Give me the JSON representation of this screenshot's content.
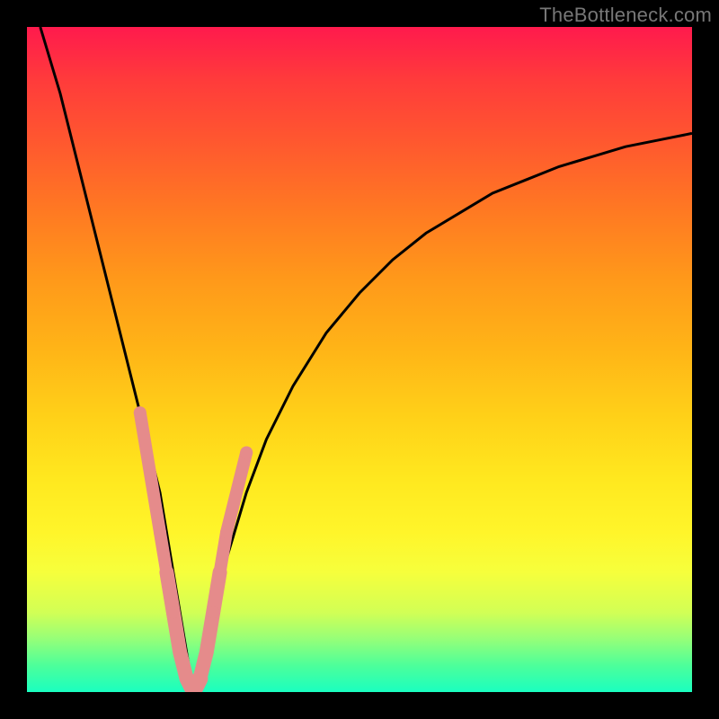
{
  "watermark": "TheBottleneck.com",
  "colors": {
    "frame": "#000000",
    "curve": "#000000",
    "marker_fill": "#e58b8b",
    "marker_stroke": "#d47272",
    "gradient_stops": [
      "#ff1a4d",
      "#ff3b3b",
      "#ff5a2e",
      "#ff7a22",
      "#ff991a",
      "#ffb317",
      "#ffcf18",
      "#ffe81f",
      "#fff52a",
      "#f6ff3c",
      "#d2ff55",
      "#96ff78",
      "#4dff9a",
      "#1affc0"
    ]
  },
  "chart_data": {
    "type": "line",
    "title": "",
    "xlabel": "",
    "ylabel": "",
    "xlim": [
      0,
      100
    ],
    "ylim": [
      0,
      100
    ],
    "note": "V-shaped bottleneck curve. y≈100 at extremes, y≈0 near x≈25. Values estimated from pixels; axes unlabeled.",
    "series": [
      {
        "name": "bottleneck-curve",
        "x": [
          2,
          5,
          8,
          11,
          14,
          17,
          20,
          22,
          24,
          25,
          26,
          28,
          30,
          33,
          36,
          40,
          45,
          50,
          55,
          60,
          65,
          70,
          75,
          80,
          85,
          90,
          95,
          100
        ],
        "y": [
          100,
          90,
          78,
          66,
          54,
          42,
          30,
          18,
          6,
          0,
          4,
          12,
          20,
          30,
          38,
          46,
          54,
          60,
          65,
          69,
          72,
          75,
          77,
          79,
          80.5,
          82,
          83,
          84
        ]
      }
    ],
    "markers": {
      "name": "highlight-points",
      "note": "Salmon rounded segments near the valley on both branches.",
      "x": [
        17,
        18,
        19,
        20,
        21,
        22,
        23,
        24,
        25,
        26,
        27,
        28,
        29,
        30,
        31,
        32,
        33
      ],
      "y": [
        42,
        36,
        30,
        24,
        18,
        12,
        6,
        2,
        0,
        2,
        6,
        12,
        18,
        24,
        28,
        32,
        36
      ]
    }
  }
}
